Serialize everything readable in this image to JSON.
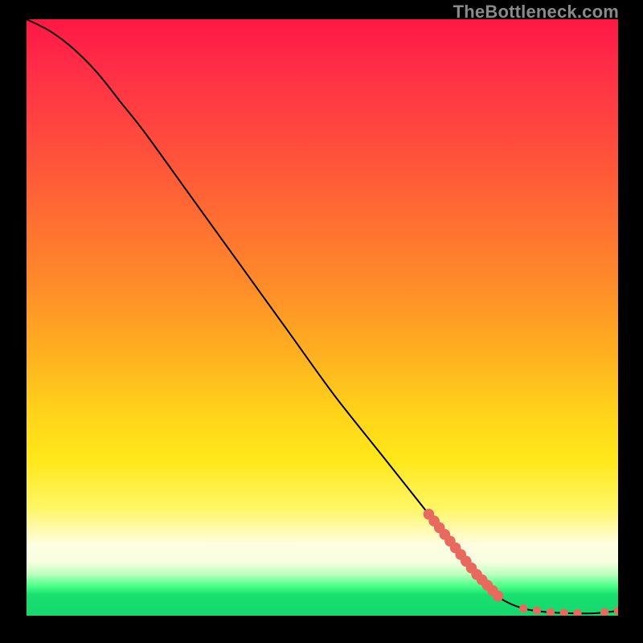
{
  "watermark": "TheBottleneck.com",
  "chart_data": {
    "type": "line",
    "title": "",
    "xlabel": "",
    "ylabel": "",
    "xlim": [
      0,
      100
    ],
    "ylim": [
      0,
      100
    ],
    "series": [
      {
        "name": "curve",
        "x": [
          0,
          4,
          8,
          12,
          16,
          20,
          28,
          36,
          44,
          52,
          60,
          68,
          76,
          80,
          84,
          88,
          92,
          96,
          100
        ],
        "y": [
          100,
          98,
          95,
          91,
          86,
          81,
          70,
          59,
          48,
          37,
          27,
          17,
          7,
          3,
          1.2,
          0.6,
          0.4,
          0.4,
          0.8
        ]
      }
    ],
    "markers": [
      {
        "series": "curve",
        "x_range": [
          68,
          80
        ],
        "dense": true
      },
      {
        "series": "curve",
        "x_range": [
          84,
          100
        ],
        "dense": false
      }
    ],
    "marker_color": "#e86a5e",
    "background_gradient": [
      "#ff1744",
      "#ffd31a",
      "#fffde0",
      "#18e070"
    ]
  }
}
